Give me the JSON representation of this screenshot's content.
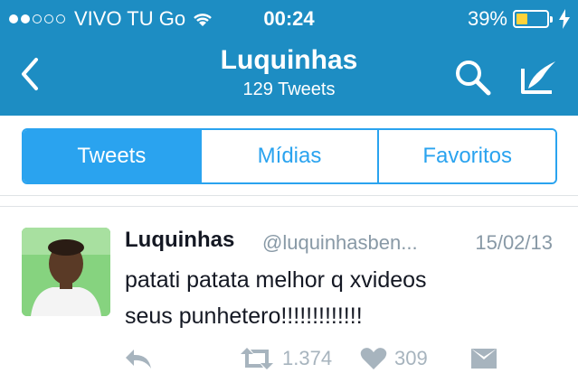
{
  "status_bar": {
    "carrier": "VIVO TU Go",
    "time": "00:24",
    "battery": "39%",
    "battery_level": 0.39
  },
  "header": {
    "title": "Luquinhas",
    "subtitle": "129 Tweets"
  },
  "tabs": [
    {
      "label": "Tweets",
      "active": true
    },
    {
      "label": "Mídias",
      "active": false
    },
    {
      "label": "Favoritos",
      "active": false
    }
  ],
  "tweet": {
    "name": "Luquinhas",
    "handle": "@luquinhasben...",
    "date": "15/02/13",
    "text_line1": "patati patata melhor q xvideos",
    "text_line2": "seus punhetero!!!!!!!!!!!!!",
    "retweets": "1.374",
    "likes": "309"
  },
  "colors": {
    "header_bg": "#1d8dc3",
    "accent": "#2aa3ef",
    "muted": "#8899a6",
    "battery_fill": "#ffd23a"
  },
  "icons": [
    "back-chevron-icon",
    "search-icon",
    "compose-icon",
    "wifi-icon",
    "charging-icon",
    "reply-icon",
    "retweet-icon",
    "heart-icon",
    "direct-message-icon"
  ]
}
